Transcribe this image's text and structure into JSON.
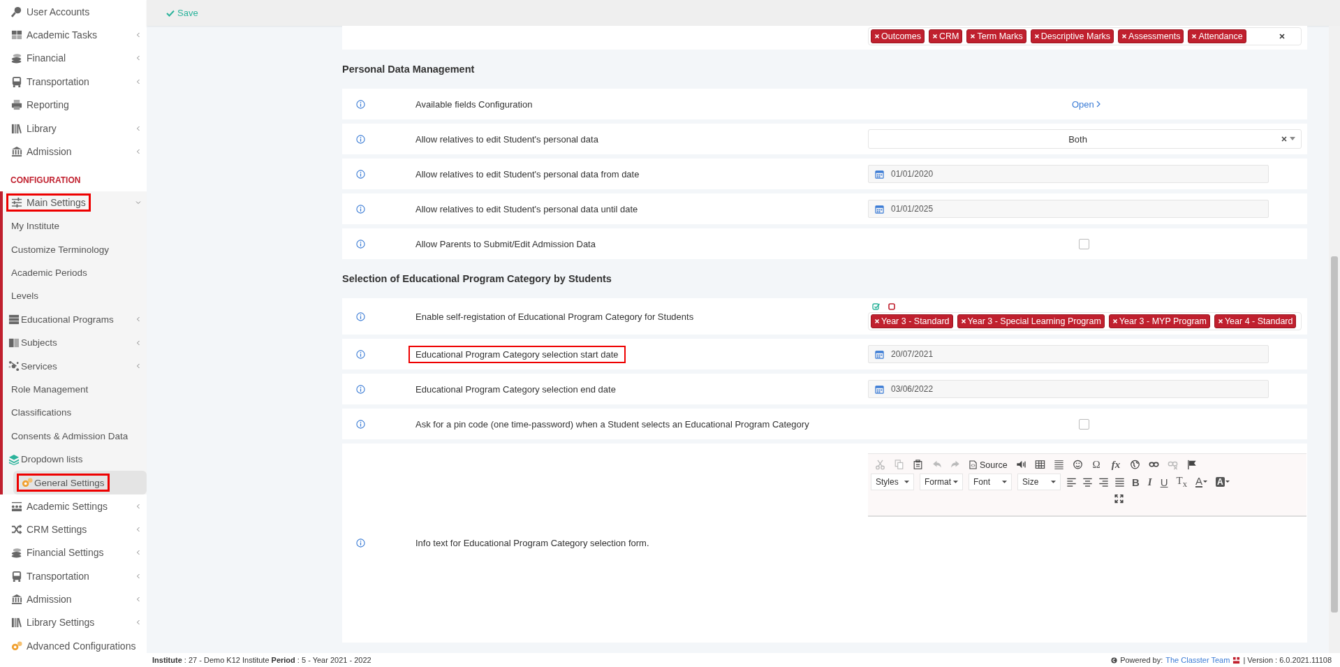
{
  "top_bar": {
    "save_label": "Save"
  },
  "sidebar": {
    "items": [
      {
        "kind": "link",
        "label": "User Accounts",
        "selected": false
      },
      {
        "kind": "link",
        "label": "Academic Tasks",
        "selected": false,
        "expanded": false
      },
      {
        "kind": "link",
        "label": "Financial",
        "selected": false,
        "expanded": false
      },
      {
        "kind": "link",
        "label": "Transportation",
        "selected": false,
        "expanded": false
      },
      {
        "kind": "link",
        "label": "Reporting",
        "selected": false
      },
      {
        "kind": "link",
        "label": "Library",
        "selected": false,
        "expanded": false
      },
      {
        "kind": "link",
        "label": "Admission",
        "selected": false,
        "expanded": false
      },
      {
        "kind": "section",
        "label": "CONFIGURATION"
      },
      {
        "kind": "link",
        "label": "Main Settings",
        "selected": false,
        "expanded": true,
        "highlighted": true,
        "children": [
          {
            "label": "My Institute",
            "selected": false
          },
          {
            "label": "Customize Terminology",
            "selected": false
          },
          {
            "label": "Academic Periods",
            "selected": false
          },
          {
            "label": "Levels",
            "selected": false
          },
          {
            "label": "Educational Programs",
            "selected": false,
            "expanded": false
          },
          {
            "label": "Subjects",
            "selected": false,
            "expanded": false
          },
          {
            "label": "Services",
            "selected": false,
            "expanded": false
          },
          {
            "label": "Role Management",
            "selected": false
          },
          {
            "label": "Classifications",
            "selected": false
          },
          {
            "label": "Consents & Admission Data",
            "selected": false
          },
          {
            "label": "Dropdown lists",
            "selected": false
          },
          {
            "label": "General Settings",
            "selected": true,
            "highlighted": true
          }
        ]
      },
      {
        "kind": "link",
        "label": "Academic Settings",
        "selected": false,
        "expanded": false
      },
      {
        "kind": "link",
        "label": "CRM Settings",
        "selected": false,
        "expanded": false
      },
      {
        "kind": "link",
        "label": "Financial Settings",
        "selected": false,
        "expanded": false
      },
      {
        "kind": "link",
        "label": "Transportation",
        "selected": false,
        "expanded": false
      },
      {
        "kind": "link",
        "label": "Admission",
        "selected": false,
        "expanded": false
      },
      {
        "kind": "link",
        "label": "Library Settings",
        "selected": false,
        "expanded": false
      },
      {
        "kind": "link",
        "label": "Advanced Configurations",
        "selected": false
      }
    ]
  },
  "sections": [
    {
      "rows": [
        {
          "kind": "tags",
          "tags": [
            "Outcomes",
            "CRM",
            "Term Marks",
            "Descriptive Marks",
            "Assessments",
            "Attendance"
          ],
          "clearable": true
        }
      ]
    },
    {
      "title": "Personal Data Management",
      "rows": [
        {
          "kind": "link",
          "label": "Available fields Configuration",
          "link": "Open"
        },
        {
          "kind": "select",
          "label": "Allow relatives to edit Student's personal data",
          "value": "Both"
        },
        {
          "kind": "date",
          "label": "Allow relatives to edit Student's personal data from date",
          "value": "01/01/2020"
        },
        {
          "kind": "date",
          "label": "Allow relatives to edit Student's personal data until date",
          "value": "01/01/2025"
        },
        {
          "kind": "checkbox",
          "label": "Allow Parents to Submit/Edit Admission Data",
          "checked": false
        }
      ]
    },
    {
      "title": "Selection of Educational Program Category by Students",
      "rows": [
        {
          "kind": "tags",
          "label": "Enable self-registation of Educational Program Category for Students",
          "tags": [
            "Year 3 - Standard",
            "Year 3 - Special Learning Program",
            "Year 3 - MYP Program",
            "Year 4 - Standard"
          ],
          "select_buttons": true
        },
        {
          "kind": "date",
          "label": "Educational Program Category selection start date",
          "value": "20/07/2021",
          "highlighted": true
        },
        {
          "kind": "date",
          "label": "Educational Program Category selection end date",
          "value": "03/06/2022"
        },
        {
          "kind": "checkbox",
          "label": "Ask for a pin code (one time-password) when a Student selects an Educational Program Category",
          "checked": false
        },
        {
          "kind": "editor",
          "label": "Info text for Educational Program Category selection form.",
          "toolbar": [
            [
              {
                "kind": "icon",
                "disabled": true
              },
              {
                "kind": "icon",
                "disabled": true
              },
              {
                "kind": "icon",
                "disabled": false
              },
              {
                "kind": "icon",
                "disabled": true
              },
              {
                "kind": "icon",
                "disabled": true
              },
              {
                "kind": "source",
                "label": "Source"
              },
              {
                "kind": "icon",
                "disabled": false
              },
              {
                "kind": "icon",
                "disabled": false
              },
              {
                "kind": "icon",
                "disabled": false
              },
              {
                "kind": "icon",
                "disabled": false
              },
              {
                "kind": "symbol",
                "label": "Ω"
              },
              {
                "kind": "italic",
                "label": "fx"
              },
              {
                "kind": "icon",
                "disabled": false
              },
              {
                "kind": "icon",
                "disabled": false
              },
              {
                "kind": "icon",
                "disabled": true
              },
              {
                "kind": "icon",
                "disabled": false
              }
            ],
            [
              {
                "kind": "dropdown",
                "label": "Styles"
              },
              {
                "kind": "dropdown",
                "label": "Format"
              },
              {
                "kind": "dropdown",
                "label": "Font"
              },
              {
                "kind": "dropdown",
                "label": "Size"
              },
              {
                "kind": "icon",
                "disabled": false
              },
              {
                "kind": "icon",
                "disabled": false
              },
              {
                "kind": "icon",
                "disabled": false
              },
              {
                "kind": "icon",
                "disabled": false
              },
              {
                "kind": "bold",
                "label": "B"
              },
              {
                "kind": "italic",
                "label": "I"
              },
              {
                "kind": "underline",
                "label": "U"
              },
              {
                "kind": "symbol",
                "label": "T$_{x}$"
              },
              {
                "kind": "color",
                "label": "A"
              },
              {
                "kind": "bgcolor",
                "label": "A"
              }
            ],
            [
              {
                "kind": "icon",
                "disabled": false
              }
            ]
          ]
        }
      ]
    }
  ],
  "footer": {
    "info": "**Institute** : 27 - Demo K12 Institute **Period** : 5 - Year 2021 - 2022",
    "powered": "Powered by:",
    "team": "The Classter Team",
    "version": "| Version : 6.0.2021.11108"
  }
}
